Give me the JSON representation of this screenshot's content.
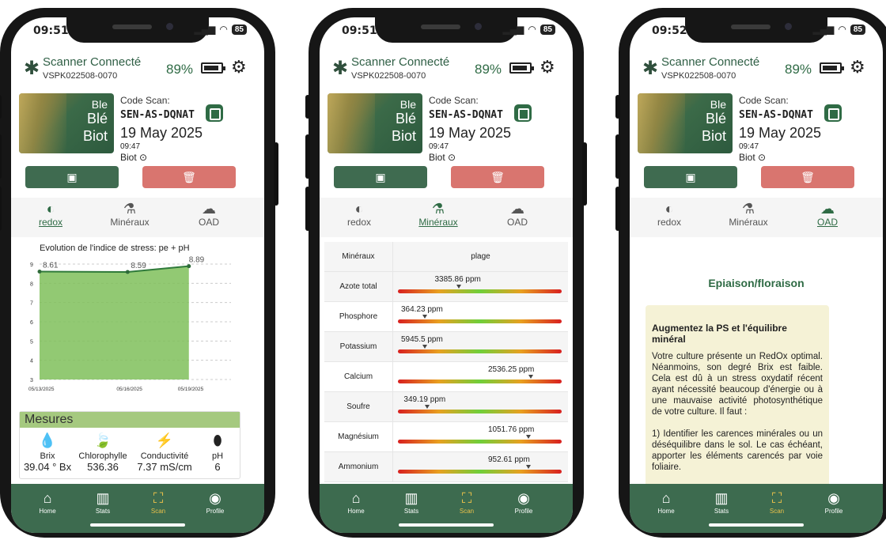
{
  "status_bar": {
    "phone1_time": "09:51",
    "phone2_time": "09:51",
    "phone3_time": "09:52",
    "battery_badge": "85"
  },
  "header": {
    "title": "Scanner Connecté",
    "device_id": "VSPK022508-0070",
    "battery_pct": "89%",
    "icons": [
      "bluetooth-icon",
      "battery-icon",
      "gear-icon"
    ]
  },
  "scan": {
    "card_l1": "Ble",
    "card_l2": "Blé",
    "card_l3": "Biot",
    "code_label": "Code Scan:",
    "code": "SEN-AS-DQNAT",
    "date": "19 May 2025",
    "time": "09:47",
    "location": "Biot"
  },
  "tabs": [
    {
      "label": "redox"
    },
    {
      "label": "Minéraux"
    },
    {
      "label": "OAD"
    }
  ],
  "phone1": {
    "chart_data": {
      "type": "area",
      "title": "Evolution de l'indice de stress: pe + pH",
      "categories": [
        "05/13/2025",
        "05/16/2025",
        "05/19/2025"
      ],
      "values": [
        8.61,
        8.59,
        8.89
      ],
      "yticks": [
        3,
        4,
        5,
        6,
        7,
        8,
        9
      ],
      "ylim": [
        3,
        9
      ]
    },
    "mesures_title": "Mesures",
    "mesures": [
      {
        "name": "Brix",
        "value": "39.04 ° Bx"
      },
      {
        "name": "Chlorophylle",
        "value": "536.36"
      },
      {
        "name": "Conductivité",
        "value": "7.37  mS/cm"
      },
      {
        "name": "pH",
        "value": "6"
      }
    ]
  },
  "phone2": {
    "col_name": "Minéraux",
    "col_range": "plage",
    "rows": [
      {
        "name": "Azote total",
        "value": "3385.86 ppm",
        "pos": 0.45
      },
      {
        "name": "Phosphore",
        "value": "364.23 ppm",
        "pos": 0.2
      },
      {
        "name": "Potassium",
        "value": "5945.5 ppm",
        "pos": 0.2
      },
      {
        "name": "Calcium",
        "value": "2536.25 ppm",
        "pos": 0.99
      },
      {
        "name": "Soufre",
        "value": "349.19 ppm",
        "pos": 0.22
      },
      {
        "name": "Magnésium",
        "value": "1051.76 ppm",
        "pos": 0.97
      },
      {
        "name": "Ammonium",
        "value": "952.61 ppm",
        "pos": 0.97
      }
    ]
  },
  "phone3": {
    "stage": "Epiaison/floraison",
    "heading": "Augmentez la PS et l'équilibre minéral",
    "para1": "Votre culture présente un RedOx optimal. Néanmoins, son degré Brix est faible. Cela est dû à un stress oxydatif récent ayant nécessité beaucoup d'énergie ou à une mauvaise activité photosynthétique de votre culture. Il faut :",
    "para2": "1) Identifier les carences minérales ou un déséquilibre dans le sol. Le cas échéant, apporter les éléments carencés par voie foliaire."
  },
  "nav": [
    {
      "label": "Home",
      "icon": "home-icon"
    },
    {
      "label": "Stats",
      "icon": "stats-icon"
    },
    {
      "label": "Scan",
      "icon": "scan-icon"
    },
    {
      "label": "Profile",
      "icon": "profile-icon"
    }
  ],
  "colors": {
    "primary": "#3d6b4f",
    "accent": "#e8c04a",
    "delete": "#d9756f",
    "chart_fill": "#7fbf5a"
  }
}
